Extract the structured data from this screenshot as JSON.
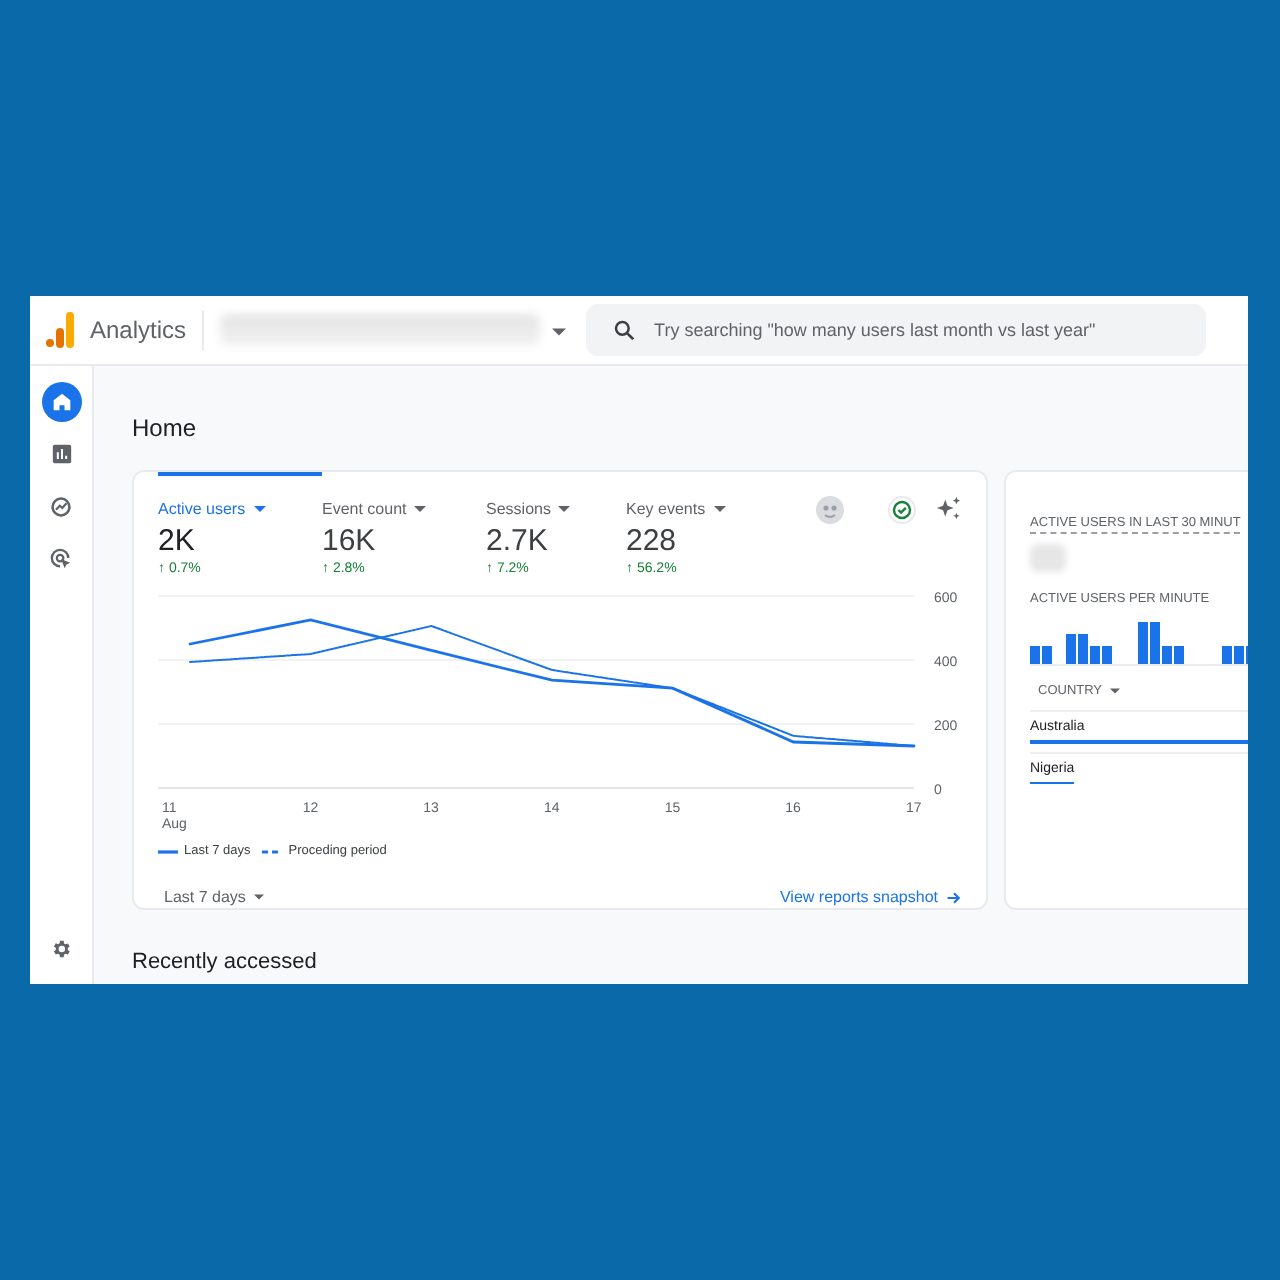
{
  "app": {
    "name": "Analytics"
  },
  "search": {
    "placeholder": "Try searching \"how many users last month vs last year\""
  },
  "sidebar": {
    "items": [
      {
        "kind": "home",
        "selected": true
      },
      {
        "kind": "reports",
        "selected": false
      },
      {
        "kind": "explore",
        "selected": false
      },
      {
        "kind": "advertising",
        "selected": false
      }
    ]
  },
  "page_title": "Home",
  "metrics": [
    {
      "label": "Active users",
      "value": "2K",
      "change": "↑ 0.7%",
      "selected": true
    },
    {
      "label": "Event count",
      "value": "16K",
      "change": "↑ 2.8%",
      "selected": false
    },
    {
      "label": "Sessions",
      "value": "2.7K",
      "change": "↑ 7.2%",
      "selected": false
    },
    {
      "label": "Key events",
      "value": "228",
      "change": "↑ 56.2%",
      "selected": false
    }
  ],
  "chart_data": {
    "type": "line",
    "categories": [
      "11",
      "12",
      "13",
      "14",
      "15",
      "16",
      "17"
    ],
    "xlabel": "Aug",
    "ylim": [
      0,
      600
    ],
    "yticks": [
      0,
      200,
      400,
      600
    ],
    "series": [
      {
        "name": "Last 7 days",
        "color": "#1a73e8",
        "line_style": "solid",
        "values": [
          450,
          525,
          430,
          337,
          312,
          144,
          131
        ]
      },
      {
        "name": "Proceding period",
        "color": "#1a73e8",
        "line_style": "dashed",
        "values": [
          394,
          419,
          506,
          369,
          312,
          163,
          131
        ]
      }
    ]
  },
  "date_range": "Last 7 days",
  "snapshot_link": "View reports snapshot",
  "realtime": {
    "title": "ACTIVE USERS IN LAST 30 MINUT",
    "subtitle": "ACTIVE USERS PER MINUTE",
    "column": "COUNTRY",
    "countries": [
      {
        "name": "Australia",
        "level": 1.0
      },
      {
        "name": "Nigeria",
        "level": 0.18
      }
    ]
  },
  "recent_title": "Recently accessed"
}
